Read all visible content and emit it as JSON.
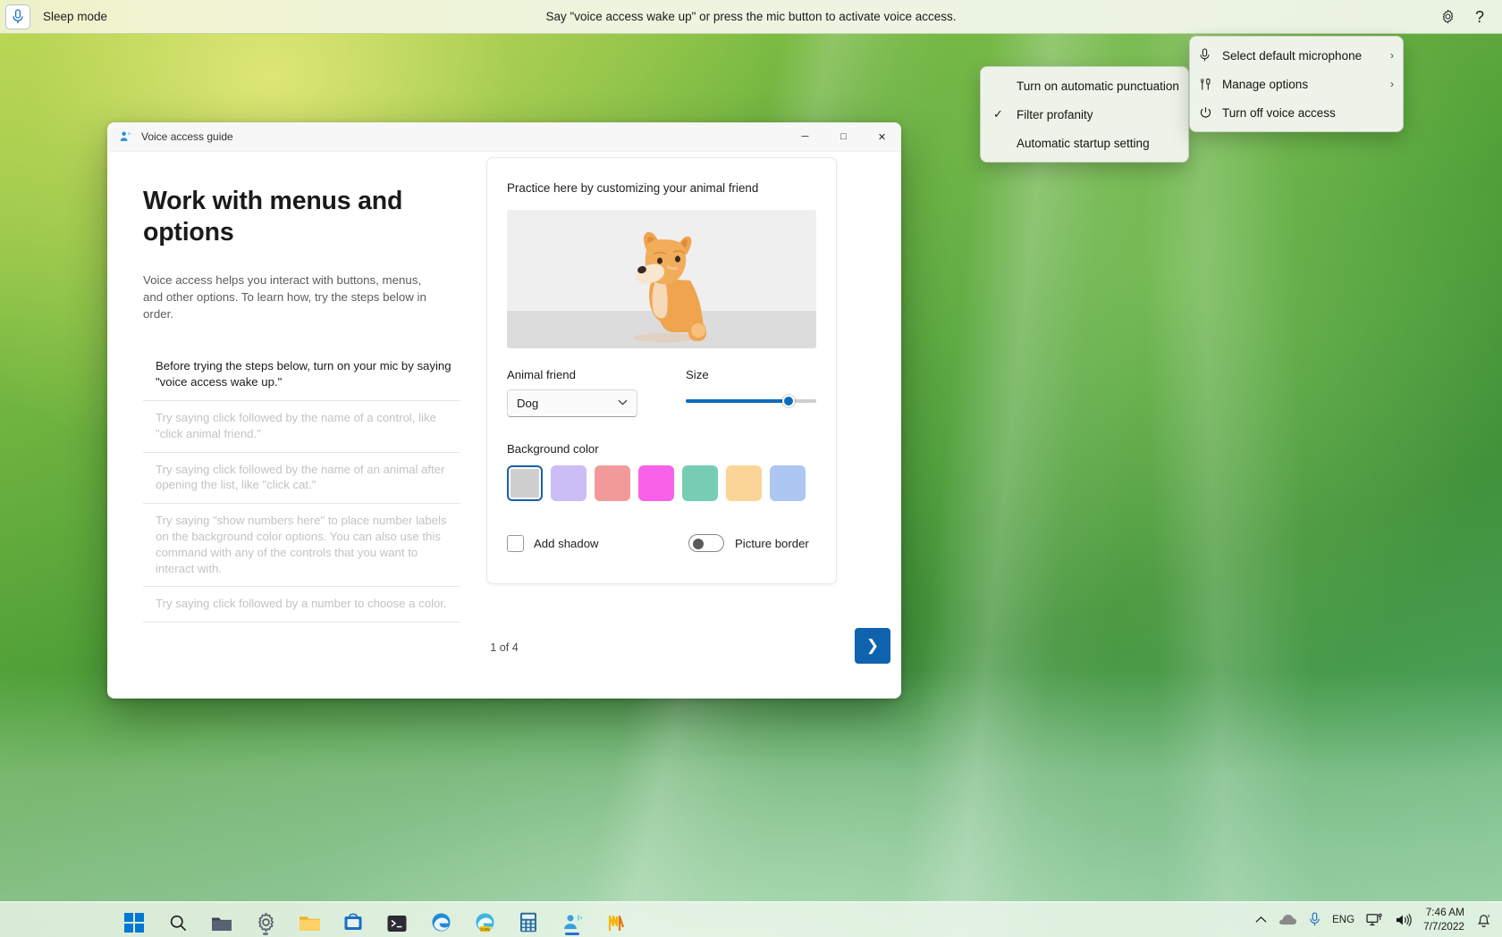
{
  "voice_access_bar": {
    "mic_icon": "microphone-icon",
    "mode_label": "Sleep mode",
    "hint": "Say \"voice access wake up\" or press the mic button to activate voice access.",
    "settings_icon": "gear-icon",
    "help_icon": "question-mark-icon"
  },
  "main_menu": {
    "items": [
      {
        "label": "Select default microphone",
        "icon": "microphone-icon",
        "submenu_chevron": "›"
      },
      {
        "label": "Manage options",
        "icon": "tools-icon",
        "submenu_chevron": "›"
      },
      {
        "label": "Turn off voice access",
        "icon": "power-icon",
        "submenu_chevron": ""
      }
    ]
  },
  "sub_menu": {
    "items": [
      {
        "label": "Turn on automatic punctuation",
        "checked": false,
        "check_glyph": ""
      },
      {
        "label": "Filter profanity",
        "checked": true,
        "check_glyph": "✓"
      },
      {
        "label": "Automatic startup setting",
        "checked": false,
        "check_glyph": ""
      }
    ]
  },
  "guide_window": {
    "app_icon": "voice-access-icon",
    "title": "Voice access guide",
    "window_controls": {
      "minimize": "─",
      "maximize": "□",
      "close": "✕"
    },
    "heading": "Work with menus and options",
    "intro": "Voice access helps you interact with buttons, menus, and other options. To learn how, try the steps below in order.",
    "steps": [
      {
        "text": "Before trying the steps below, turn on your mic by saying \"voice access wake up.\"",
        "state": "active"
      },
      {
        "text": "Try saying click followed by the name of a control, like \"click animal friend.\"",
        "state": "muted"
      },
      {
        "text": "Try saying click followed by the name of an animal after opening the list, like \"click cat.\"",
        "state": "muted"
      },
      {
        "text": "Try saying \"show numbers here\" to place number labels on the background color options. You can also use this command with any of the controls that you want to interact with.",
        "state": "muted"
      },
      {
        "text": "Try saying click followed by a number to choose a color.",
        "state": "muted"
      }
    ],
    "practice": {
      "title": "Practice here by customizing your animal friend",
      "animal_label": "Animal friend",
      "animal_value": "Dog",
      "animal_chevron": "⌄",
      "size_label": "Size",
      "size_percent": 79,
      "background_color_label": "Background color",
      "swatches": [
        {
          "name": "gray",
          "color": "#cfcfcf",
          "selected": true
        },
        {
          "name": "lavender",
          "color": "#cbbdf5",
          "selected": false
        },
        {
          "name": "salmon",
          "color": "#f29a9a",
          "selected": false
        },
        {
          "name": "magenta",
          "color": "#f862e8",
          "selected": false
        },
        {
          "name": "teal",
          "color": "#77cdb4",
          "selected": false
        },
        {
          "name": "peach",
          "color": "#fbd598",
          "selected": false
        },
        {
          "name": "light-blue",
          "color": "#adc6f2",
          "selected": false
        }
      ],
      "add_shadow_label": "Add shadow",
      "add_shadow_checked": false,
      "picture_border_label": "Picture border",
      "picture_border_on": false
    },
    "footer": {
      "page_indicator": "1 of 4",
      "next_glyph": "❯"
    }
  },
  "taskbar": {
    "apps": [
      {
        "name": "start-button",
        "state": "none"
      },
      {
        "name": "search-button",
        "state": "none"
      },
      {
        "name": "file-explorer-dark",
        "state": "none"
      },
      {
        "name": "settings-button",
        "state": "running"
      },
      {
        "name": "file-explorer",
        "state": "none"
      },
      {
        "name": "store-button",
        "state": "none"
      },
      {
        "name": "terminal-button",
        "state": "none"
      },
      {
        "name": "edge-button",
        "state": "none"
      },
      {
        "name": "edge-canary-button",
        "state": "none"
      },
      {
        "name": "calculator-button",
        "state": "none"
      },
      {
        "name": "voice-access-button",
        "state": "active"
      },
      {
        "name": "app-button",
        "state": "none"
      }
    ],
    "tray": {
      "chevron": "∧",
      "cloud_icon": "cloud-icon",
      "mic_icon": "microphone-icon",
      "language": "ENG",
      "network_icon": "network-icon",
      "volume_icon": "volume-icon",
      "time": "7:46 AM",
      "date": "7/7/2022",
      "notification_icon": "notification-bell-icon"
    }
  }
}
